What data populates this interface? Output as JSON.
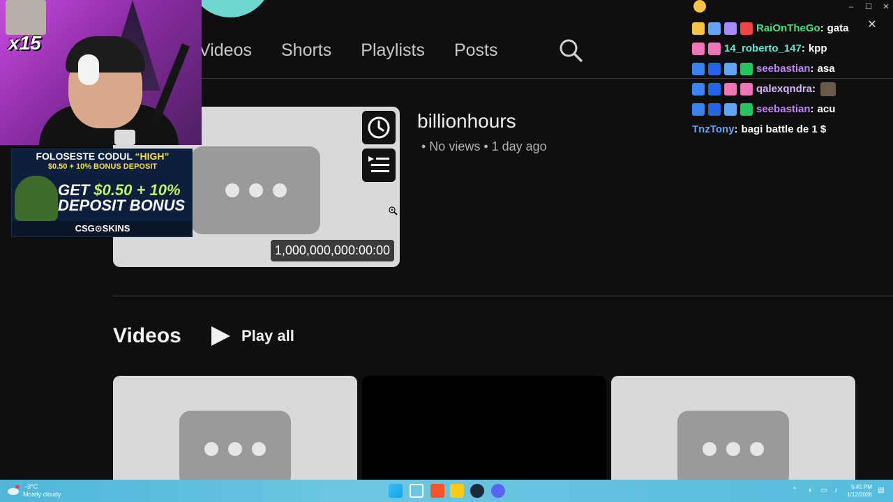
{
  "channel_tabs": {
    "items": [
      {
        "label": "Videos"
      },
      {
        "label": "Shorts"
      },
      {
        "label": "Playlists"
      },
      {
        "label": "Posts"
      }
    ]
  },
  "featured_video": {
    "title": "billionhours",
    "meta": "• No views • 1 day ago",
    "duration": "1,000,000,000:00:00"
  },
  "videos_section": {
    "title": "Videos",
    "play_all_label": "Play all"
  },
  "stream_overlay": {
    "multiplier": "x15",
    "sponsor": {
      "line1_prefix": "FOLOSESTE CODUL ",
      "line1_code": "“HIGH”",
      "line2": "$0.50 + 10% BONUS DEPOSIT",
      "get_line1_prefix": "GET ",
      "get_line1_amount": "$0.50 + 10%",
      "get_line2": "DEPOSIT BONUS",
      "brand": "CSG⊙SKINS"
    }
  },
  "chat": {
    "messages": [
      {
        "user": "RaiOnTheGo",
        "text": "gata",
        "color": "#4ade80",
        "badges": [
          "#f5c542",
          "#60a5fa",
          "#a78bfa",
          "#ef4444"
        ]
      },
      {
        "user": "14_roberto_147",
        "text": "kpp",
        "color": "#5eead4",
        "badges": [
          "#f472b6",
          "#f472b6"
        ]
      },
      {
        "user": "seebastian",
        "text": "asa",
        "color": "#c084fc",
        "badges": [
          "#3b82f6",
          "#2563eb",
          "#60a5fa",
          "#22c55e"
        ]
      },
      {
        "user": "qalexqndra",
        "text": "",
        "color": "#d8b4fe",
        "badges": [
          "#3b82f6",
          "#2563eb",
          "#f472b6",
          "#f472b6"
        ],
        "emote": true
      },
      {
        "user": "seebastian",
        "text": "acu",
        "color": "#c084fc",
        "badges": [
          "#3b82f6",
          "#2563eb",
          "#60a5fa",
          "#22c55e"
        ]
      },
      {
        "user": "TnzTony",
        "text": "bagi battle de 1 $",
        "color": "#60a5fa",
        "badges": []
      }
    ]
  },
  "taskbar": {
    "weather_temp": "-3°C",
    "weather_desc": "Mostly cloudy",
    "time": "5:45 PM",
    "date": "1/12/2026"
  }
}
